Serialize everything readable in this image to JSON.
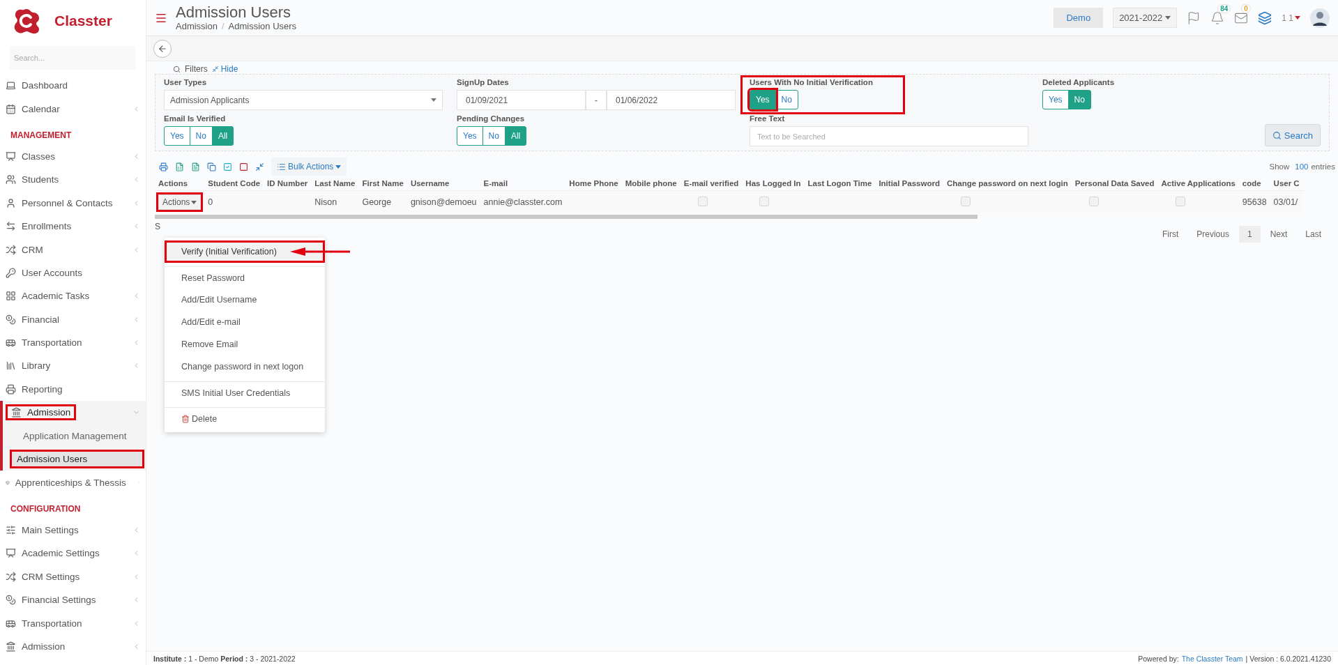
{
  "brand": {
    "name": "Classter"
  },
  "sidebar": {
    "search": {
      "placeholder": "Search..."
    },
    "items": [
      {
        "kind": "item",
        "label": "Dashboard",
        "has_children": false
      },
      {
        "kind": "item",
        "label": "Calendar",
        "has_children": true
      },
      {
        "kind": "section",
        "label": "MANAGEMENT"
      },
      {
        "kind": "item",
        "label": "Classes",
        "has_children": true
      },
      {
        "kind": "item",
        "label": "Students",
        "has_children": true
      },
      {
        "kind": "item",
        "label": "Personnel & Contacts",
        "has_children": true
      },
      {
        "kind": "item",
        "label": "Enrollments",
        "has_children": true
      },
      {
        "kind": "item",
        "label": "CRM",
        "has_children": true
      },
      {
        "kind": "item",
        "label": "User Accounts",
        "has_children": false
      },
      {
        "kind": "item",
        "label": "Academic Tasks",
        "has_children": true
      },
      {
        "kind": "item",
        "label": "Financial",
        "has_children": true
      },
      {
        "kind": "item",
        "label": "Transportation",
        "has_children": true
      },
      {
        "kind": "item",
        "label": "Library",
        "has_children": true
      },
      {
        "kind": "item",
        "label": "Reporting",
        "has_children": false
      },
      {
        "kind": "item",
        "label": "Admission",
        "has_children": true,
        "expanded": true,
        "highlighted": true,
        "children": [
          {
            "label": "Application Management",
            "selected": false,
            "highlighted": false
          },
          {
            "label": "Admission Users",
            "selected": true,
            "highlighted": true
          }
        ]
      },
      {
        "kind": "item",
        "label": "Apprenticeships & Thessis",
        "has_children": true
      },
      {
        "kind": "section",
        "label": "CONFIGURATION"
      },
      {
        "kind": "item",
        "label": "Main Settings",
        "has_children": true
      },
      {
        "kind": "item",
        "label": "Academic Settings",
        "has_children": true
      },
      {
        "kind": "item",
        "label": "CRM Settings",
        "has_children": true
      },
      {
        "kind": "item",
        "label": "Financial Settings",
        "has_children": true
      },
      {
        "kind": "item",
        "label": "Transportation",
        "has_children": true
      },
      {
        "kind": "item",
        "label": "Admission",
        "has_children": true
      }
    ]
  },
  "header": {
    "title": "Admission Users",
    "breadcrumb": [
      "Admission",
      "Admission Users"
    ],
    "breadcrumb_separator": "/",
    "school": "Demo",
    "period": "2021-2022",
    "notifications": "84",
    "messages": "0",
    "user": "1 1"
  },
  "filters": {
    "label": "Filters",
    "hide_link": "Hide",
    "fields": [
      {
        "kind": "select",
        "label": "User Types",
        "value": "Admission Applicants",
        "highlighted": false
      },
      {
        "kind": "date_range",
        "label": "SignUp Dates",
        "from": "01/09/2021",
        "separator": "-",
        "to": "01/06/2022",
        "highlighted": false
      },
      {
        "kind": "toggle",
        "label": "Users With No Initial Verification",
        "highlighted": true,
        "options": [
          {
            "label": "Yes",
            "selected": true,
            "highlighted": true
          },
          {
            "label": "No",
            "selected": false,
            "highlighted": false
          }
        ]
      },
      {
        "kind": "toggle",
        "label": "Deleted Applicants",
        "highlighted": false,
        "options": [
          {
            "label": "Yes",
            "selected": false,
            "highlighted": false
          },
          {
            "label": "No",
            "selected": true,
            "highlighted": false
          }
        ]
      },
      {
        "kind": "toggle",
        "label": "Email Is Verified",
        "highlighted": false,
        "options": [
          {
            "label": "Yes",
            "selected": false,
            "highlighted": false
          },
          {
            "label": "No",
            "selected": false,
            "highlighted": false
          },
          {
            "label": "All",
            "selected": true,
            "highlighted": false
          }
        ]
      },
      {
        "kind": "toggle",
        "label": "Pending Changes",
        "highlighted": false,
        "options": [
          {
            "label": "Yes",
            "selected": false,
            "highlighted": false
          },
          {
            "label": "No",
            "selected": false,
            "highlighted": false
          },
          {
            "label": "All",
            "selected": true,
            "highlighted": false
          }
        ]
      },
      {
        "kind": "text",
        "label": "Free Text",
        "placeholder": "Text to be Searched",
        "highlighted": false
      }
    ],
    "search_button": "Search"
  },
  "toolbar": {
    "bulk_actions": "Bulk Actions",
    "page_size_label": "Show",
    "page_size": "100",
    "page_size_suffix": "entries"
  },
  "table": {
    "columns": [
      "Actions",
      "Student Code",
      "ID Number",
      "Last Name",
      "First Name",
      "Username",
      "E-mail",
      "Home Phone",
      "Mobile phone",
      "E-mail verified",
      "Has Logged In",
      "Last Logon Time",
      "Initial Password",
      "Change password on next login",
      "Personal Data Saved",
      "Active Applications",
      "code",
      "User C"
    ],
    "rows": [
      {
        "cells": [
          {
            "kind": "actions",
            "label": "Actions",
            "highlighted": true
          },
          {
            "kind": "text",
            "value": "0"
          },
          {
            "kind": "empty"
          },
          {
            "kind": "text",
            "value": "Nison"
          },
          {
            "kind": "text",
            "value": "George"
          },
          {
            "kind": "text",
            "value": "gnison@demoeu"
          },
          {
            "kind": "text",
            "value": "annie@classter.com"
          },
          {
            "kind": "empty"
          },
          {
            "kind": "empty"
          },
          {
            "kind": "checkbox",
            "checked": false
          },
          {
            "kind": "checkbox",
            "checked": false
          },
          {
            "kind": "empty"
          },
          {
            "kind": "empty"
          },
          {
            "kind": "checkbox",
            "checked": false
          },
          {
            "kind": "checkbox",
            "checked": false
          },
          {
            "kind": "checkbox",
            "checked": false
          },
          {
            "kind": "text",
            "value": "95638"
          },
          {
            "kind": "text",
            "value": "03/01/"
          }
        ]
      }
    ],
    "info": "S"
  },
  "actions_menu": [
    {
      "kind": "item",
      "label": "Verify (Initial Verification)",
      "highlighted": true,
      "pointer_arrow": true,
      "divider_before": false
    },
    {
      "kind": "item",
      "label": "Reset Password",
      "highlighted": false,
      "pointer_arrow": false,
      "divider_before": true
    },
    {
      "kind": "item",
      "label": "Add/Edit Username",
      "highlighted": false,
      "pointer_arrow": false,
      "divider_before": false
    },
    {
      "kind": "item",
      "label": "Add/Edit e-mail",
      "highlighted": false,
      "pointer_arrow": false,
      "divider_before": false
    },
    {
      "kind": "item",
      "label": "Remove Email",
      "highlighted": false,
      "pointer_arrow": false,
      "divider_before": false
    },
    {
      "kind": "item",
      "label": "Change password in next logon",
      "highlighted": false,
      "pointer_arrow": false,
      "divider_before": false
    },
    {
      "kind": "item",
      "label": "SMS Initial User Credentials",
      "highlighted": false,
      "pointer_arrow": false,
      "divider_before": true
    },
    {
      "kind": "delete",
      "label": "Delete",
      "highlighted": false,
      "pointer_arrow": false,
      "divider_before": true
    }
  ],
  "pagination": [
    {
      "label": "First",
      "selected": false
    },
    {
      "label": "Previous",
      "selected": false
    },
    {
      "label": "1",
      "selected": true
    },
    {
      "label": "Next",
      "selected": false
    },
    {
      "label": "Last",
      "selected": false
    }
  ],
  "footer": {
    "left": "**Institute :** 1 - Demo **Period :** 3 - 2021-2022",
    "powered_label": "Powered by:",
    "powered_link": "The Classter Team",
    "version": "| Version : 6.0.2021.41230"
  }
}
